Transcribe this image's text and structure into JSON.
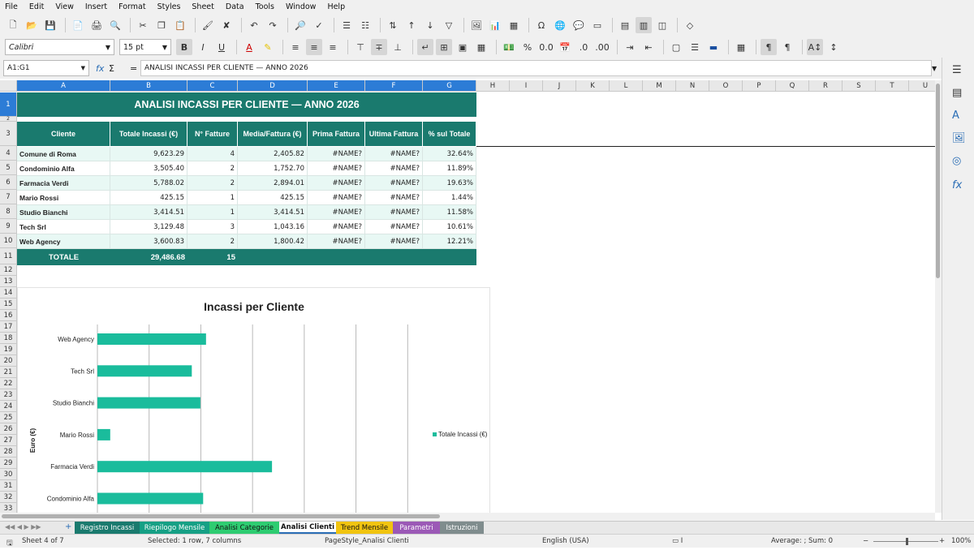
{
  "menu": [
    "File",
    "Edit",
    "View",
    "Insert",
    "Format",
    "Styles",
    "Sheet",
    "Data",
    "Tools",
    "Window",
    "Help"
  ],
  "format": {
    "font_name": "Calibri",
    "font_size": "15 pt"
  },
  "formula_bar": {
    "cell_ref": "A1:G1",
    "content": "ANALISI INCASSI PER CLIENTE — ANNO 2026"
  },
  "columns": [
    "A",
    "B",
    "C",
    "D",
    "E",
    "F",
    "G",
    "H",
    "I",
    "J",
    "K",
    "L",
    "M",
    "N",
    "O",
    "P",
    "Q",
    "R",
    "S",
    "T",
    "U"
  ],
  "rows": [
    "1",
    "2",
    "3",
    "4",
    "5",
    "6",
    "7",
    "8",
    "9",
    "10",
    "11",
    "12",
    "13",
    "14",
    "15",
    "16",
    "17",
    "18",
    "19",
    "20",
    "21",
    "22",
    "23",
    "24",
    "25",
    "26",
    "27",
    "28",
    "29",
    "30",
    "31",
    "32",
    "33"
  ],
  "sheet": {
    "title": "ANALISI INCASSI PER CLIENTE — ANNO 2026",
    "headers": [
      "Cliente",
      "Totale Incassi (€)",
      "N° Fatture",
      "Media/Fattura (€)",
      "Prima Fattura",
      "Ultima Fattura",
      "% sul Totale"
    ],
    "rows": [
      [
        "Comune di Roma",
        "9,623.29",
        "4",
        "2,405.82",
        "#NAME?",
        "#NAME?",
        "32.64%"
      ],
      [
        "Condominio Alfa",
        "3,505.40",
        "2",
        "1,752.70",
        "#NAME?",
        "#NAME?",
        "11.89%"
      ],
      [
        "Farmacia Verdi",
        "5,788.02",
        "2",
        "2,894.01",
        "#NAME?",
        "#NAME?",
        "19.63%"
      ],
      [
        "Mario Rossi",
        "425.15",
        "1",
        "425.15",
        "#NAME?",
        "#NAME?",
        "1.44%"
      ],
      [
        "Studio Bianchi",
        "3,414.51",
        "1",
        "3,414.51",
        "#NAME?",
        "#NAME?",
        "11.58%"
      ],
      [
        "Tech Srl",
        "3,129.48",
        "3",
        "1,043.16",
        "#NAME?",
        "#NAME?",
        "10.61%"
      ],
      [
        "Web Agency",
        "3,600.83",
        "2",
        "1,800.42",
        "#NAME?",
        "#NAME?",
        "12.21%"
      ]
    ],
    "total": {
      "label": "TOTALE",
      "amount": "29,486.68",
      "count": "15"
    }
  },
  "chart_data": {
    "type": "bar",
    "orientation": "horizontal",
    "title": "Incassi per Cliente",
    "ylabel": "Euro (€)",
    "categories": [
      "Web Agency",
      "Tech Srl",
      "Studio Bianchi",
      "Mario Rossi",
      "Farmacia Verdi",
      "Condominio Alfa"
    ],
    "series": [
      {
        "name": "Totale Incassi (€)",
        "values": [
          3600.83,
          3129.48,
          3414.51,
          425.15,
          5788.02,
          3505.4
        ]
      }
    ],
    "xlim": [
      0,
      12000
    ],
    "grid": true,
    "legend": "right",
    "bar_color": "#1abc9c"
  },
  "tabs": [
    {
      "label": "Registro Incassi",
      "color": "#1a7a6e",
      "text": "#ffffff"
    },
    {
      "label": "Riepilogo Mensile",
      "color": "#16a085",
      "text": "#ffffff"
    },
    {
      "label": "Analisi Categorie",
      "color": "#2ecc71",
      "text": "#111111"
    },
    {
      "label": "Analisi Clienti",
      "color": "#ffffff",
      "text": "#111111"
    },
    {
      "label": "Trend Mensile",
      "color": "#f1c40f",
      "text": "#111111"
    },
    {
      "label": "Parametri",
      "color": "#9b59b6",
      "text": "#ffffff"
    },
    {
      "label": "Istruzioni",
      "color": "#7f8c8d",
      "text": "#ffffff"
    }
  ],
  "status": {
    "sheet": "Sheet 4 of 7",
    "selection": "Selected: 1 row, 7 columns",
    "page_style": "PageStyle_Analisi Clienti",
    "language": "English (USA)",
    "sum": "Average: ; Sum: 0",
    "zoom": "100%"
  }
}
